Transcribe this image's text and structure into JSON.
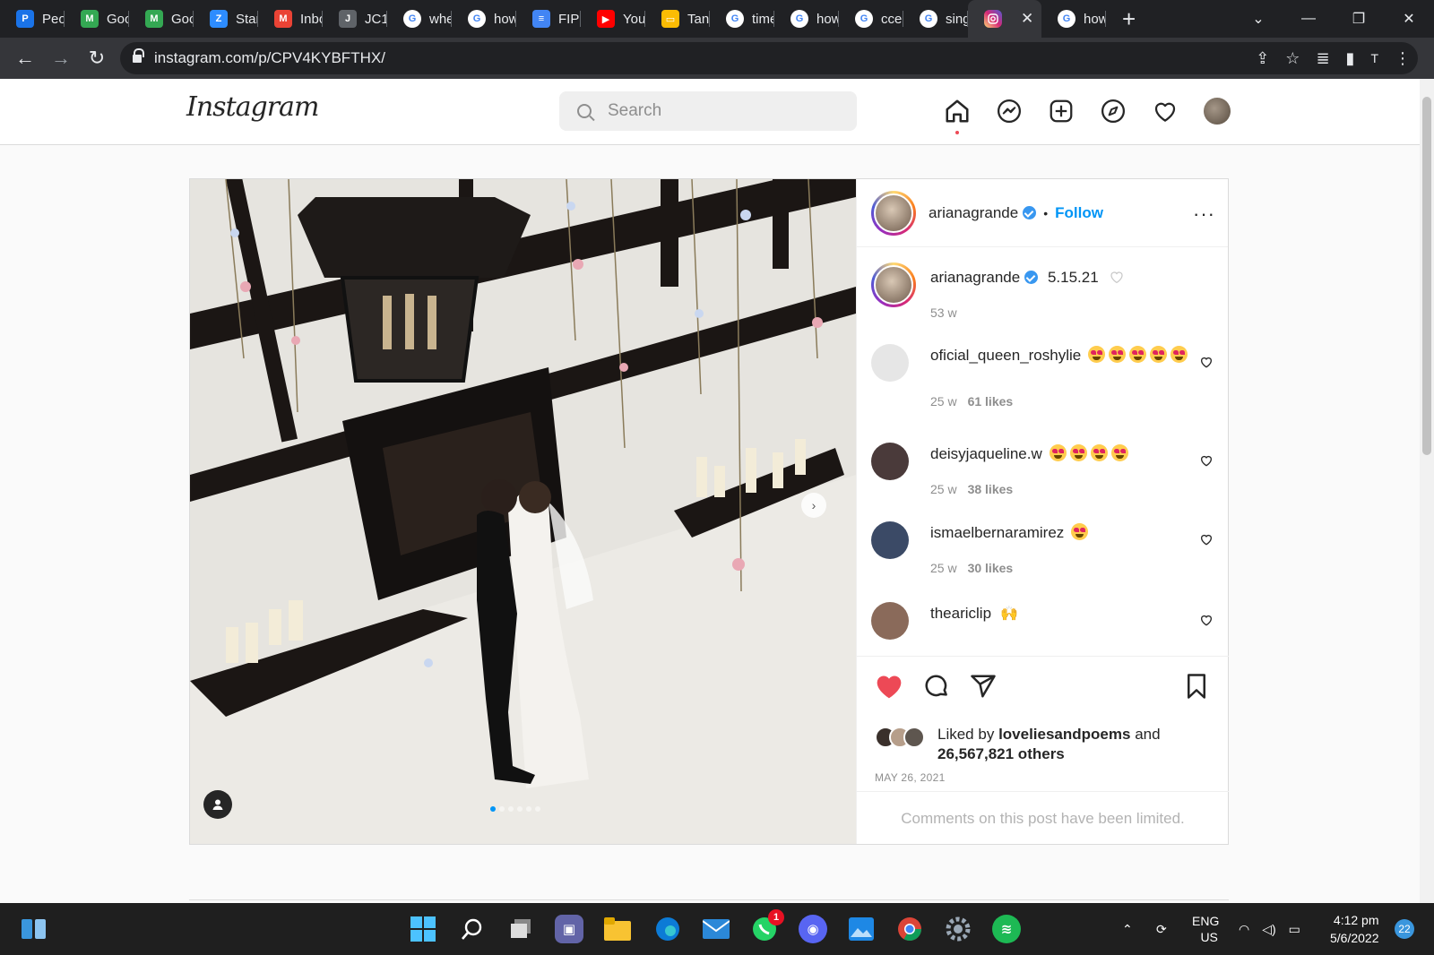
{
  "browser": {
    "tabs": [
      {
        "title": "Peo",
        "color": "#1a73e8",
        "glyph": "P"
      },
      {
        "title": "Goo",
        "color": "#34a853",
        "glyph": "M"
      },
      {
        "title": "Goo",
        "color": "#34a853",
        "glyph": "M"
      },
      {
        "title": "Star",
        "color": "#2d8cff",
        "glyph": "Z"
      },
      {
        "title": "Inbo",
        "color": "#ea4335",
        "glyph": "M"
      },
      {
        "title": "JC1",
        "color": "#5f6368",
        "glyph": "J"
      },
      {
        "title": "whe",
        "color": "#ffffff",
        "glyph": "G"
      },
      {
        "title": "how",
        "color": "#ffffff",
        "glyph": "G"
      },
      {
        "title": "FIP",
        "color": "#4285f4",
        "glyph": "≡"
      },
      {
        "title": "You",
        "color": "#ff0000",
        "glyph": "▶"
      },
      {
        "title": "Tan",
        "color": "#fbbc04",
        "glyph": "▭"
      },
      {
        "title": "time",
        "color": "#ffffff",
        "glyph": "G"
      },
      {
        "title": "how",
        "color": "#ffffff",
        "glyph": "G"
      },
      {
        "title": "cce",
        "color": "#ffffff",
        "glyph": "G"
      },
      {
        "title": "sing",
        "color": "#ffffff",
        "glyph": "G"
      }
    ],
    "active_tab_icon": "instagram-icon",
    "after_tabs": [
      {
        "title": "how",
        "color": "#ffffff",
        "glyph": "G"
      }
    ],
    "url": "instagram.com/p/CPV4KYBFTHX/",
    "profile_initial": "T"
  },
  "instagram": {
    "logo": "Instagram",
    "search_placeholder": "Search",
    "nav_icons": [
      "home-icon",
      "messenger-icon",
      "new-post-icon",
      "explore-icon",
      "activity-heart-icon",
      "profile-avatar"
    ]
  },
  "post": {
    "author": "arianagrande",
    "follow_label": "Follow",
    "separator": "•",
    "more_label": "···",
    "caption": {
      "user": "arianagrande",
      "text": "5.15.21",
      "age": "53 w"
    },
    "comments": [
      {
        "user": "oficial_queen_roshylie",
        "emoji_count": 5,
        "age": "25 w",
        "likes": "61 likes",
        "avatar": "#e6e6e6"
      },
      {
        "user": "deisyjaqueline.w",
        "emoji_count": 4,
        "age": "25 w",
        "likes": "38 likes",
        "avatar": "#4a3a3a"
      },
      {
        "user": "ismaelbernaramirez",
        "emoji_count": 1,
        "age": "25 w",
        "likes": "30 likes",
        "avatar": "#3b4a66"
      },
      {
        "user": "theariclip",
        "emoji_count": 0,
        "hands": "🙌",
        "avatar": "#8a6a5a"
      }
    ],
    "liked_by_prefix": "Liked by",
    "liked_by_user": "loveliesandpoems",
    "liked_by_and": "and",
    "likes_count": "26,567,821 others",
    "date": "MAY 26, 2021",
    "comments_limited": "Comments on this post have been limited.",
    "carousel": {
      "total": 6,
      "current": 1
    }
  },
  "taskbar": {
    "lang": "ENG",
    "region": "US",
    "time": "4:12 pm",
    "date": "5/6/2022",
    "notifications": "22",
    "whatsapp_badge": "1"
  }
}
